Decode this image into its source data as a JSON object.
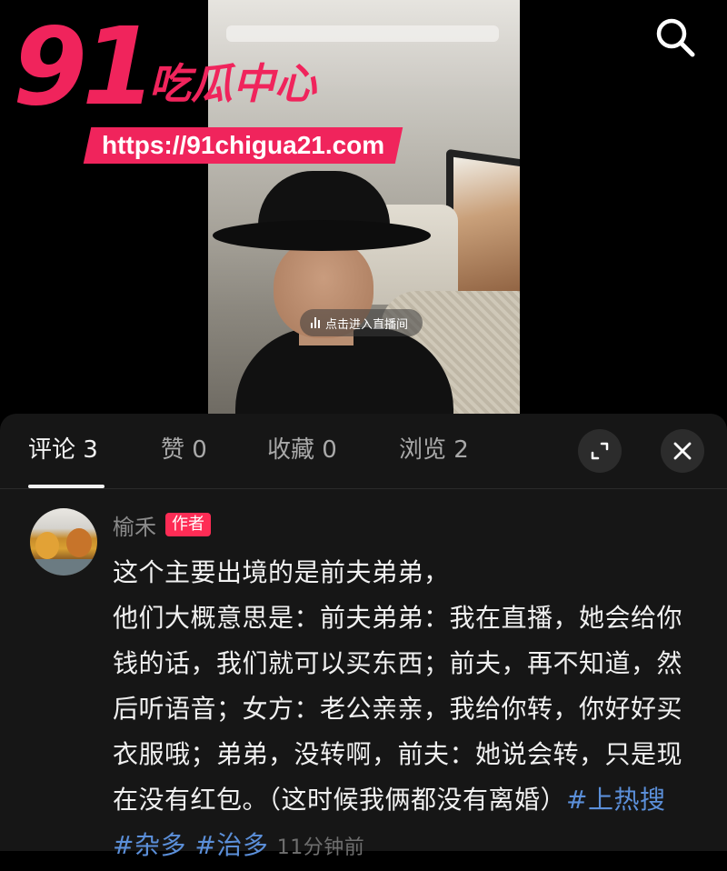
{
  "watermark": {
    "number": "91",
    "title": "吃瓜中心",
    "url": "https://91chigua21.com"
  },
  "video": {
    "live_prompt": "点击进入直播间"
  },
  "tabs": [
    {
      "label": "评论 3",
      "active": true
    },
    {
      "label": "赞 0",
      "active": false
    },
    {
      "label": "收藏 0",
      "active": false
    },
    {
      "label": "浏览 2",
      "active": false
    }
  ],
  "comment": {
    "author": "榆禾",
    "badge": "作者",
    "text": "这个主要出境的是前夫弟弟，\n他们大概意思是：前夫弟弟：我在直播，她会给你钱的话，我们就可以买东西；前夫，再不知道，然后听语音；女方：老公亲亲，我给你转，你好好买衣服哦；弟弟，没转啊，前夫：她说会转，只是现在没有红包。（这时候我俩都没有离婚）",
    "hashtags": [
      "#上热搜",
      "#杂多",
      "#治多"
    ],
    "time": "11分钟前"
  },
  "colors": {
    "accent": "#f0245c",
    "badge": "#fe2c55",
    "hashtag": "#5b8fd9",
    "sheet_bg": "#161616"
  },
  "icons": {
    "search": "search-icon",
    "expand": "expand-icon",
    "close": "close-icon",
    "live": "live-bars-icon"
  }
}
